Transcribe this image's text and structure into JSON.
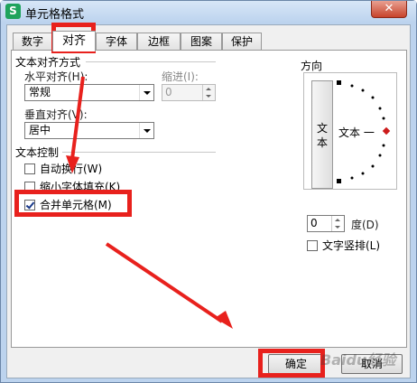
{
  "window": {
    "title": "单元格格式",
    "app_icon": "S",
    "close_glyph": "✕"
  },
  "tabs": [
    "数字",
    "对齐",
    "字体",
    "边框",
    "图案",
    "保护"
  ],
  "alignment": {
    "section_label": "文本对齐方式",
    "horizontal_label": "水平对齐(H):",
    "horizontal_value": "常规",
    "indent_label": "缩进(I):",
    "indent_value": "0",
    "vertical_label": "垂直对齐(V):",
    "vertical_value": "居中"
  },
  "text_control": {
    "section_label": "文本控制",
    "wrap_text": {
      "label": "自动换行(W)",
      "checked": false
    },
    "shrink_to_fit": {
      "label": "缩小字体填充(K)",
      "checked": false
    },
    "merge_cells": {
      "label": "合并单元格(M)",
      "checked": true
    }
  },
  "orientation": {
    "section_label": "方向",
    "vertical_text_button": "文本",
    "text_label": "文本 一",
    "degree_value": "0",
    "degree_label": "度(D)",
    "vertical_layout_label": "文字竖排(L)",
    "vertical_layout_checked": false
  },
  "buttons": {
    "ok": "确定",
    "cancel": "取消"
  },
  "watermark": "Baidu经验",
  "colors": {
    "highlight": "#e8211d",
    "marker": "#cc1b1b"
  }
}
